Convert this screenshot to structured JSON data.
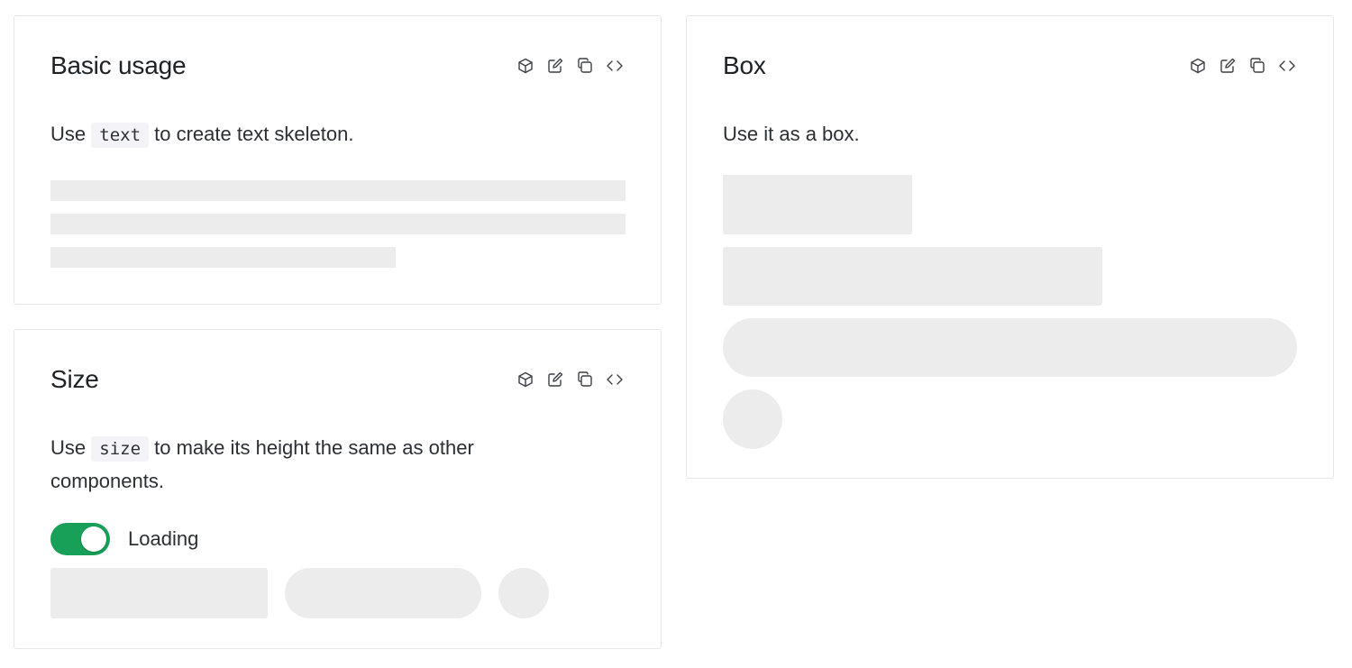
{
  "cards": {
    "basic": {
      "title": "Basic usage",
      "desc_pre": "Use",
      "desc_code": "text",
      "desc_post": "to create text skeleton."
    },
    "size": {
      "title": "Size",
      "desc_pre": "Use",
      "desc_code": "size",
      "desc_post": "to make its height the same as other components.",
      "switch_label": "Loading",
      "switch_on": true
    },
    "box": {
      "title": "Box",
      "desc": "Use it as a box."
    }
  },
  "toolbar_icons": [
    "cube-icon",
    "edit-icon",
    "copy-icon",
    "code-icon"
  ],
  "colors": {
    "accent": "#18a058",
    "skeleton": "#ececec",
    "border": "#e7e7ea"
  }
}
